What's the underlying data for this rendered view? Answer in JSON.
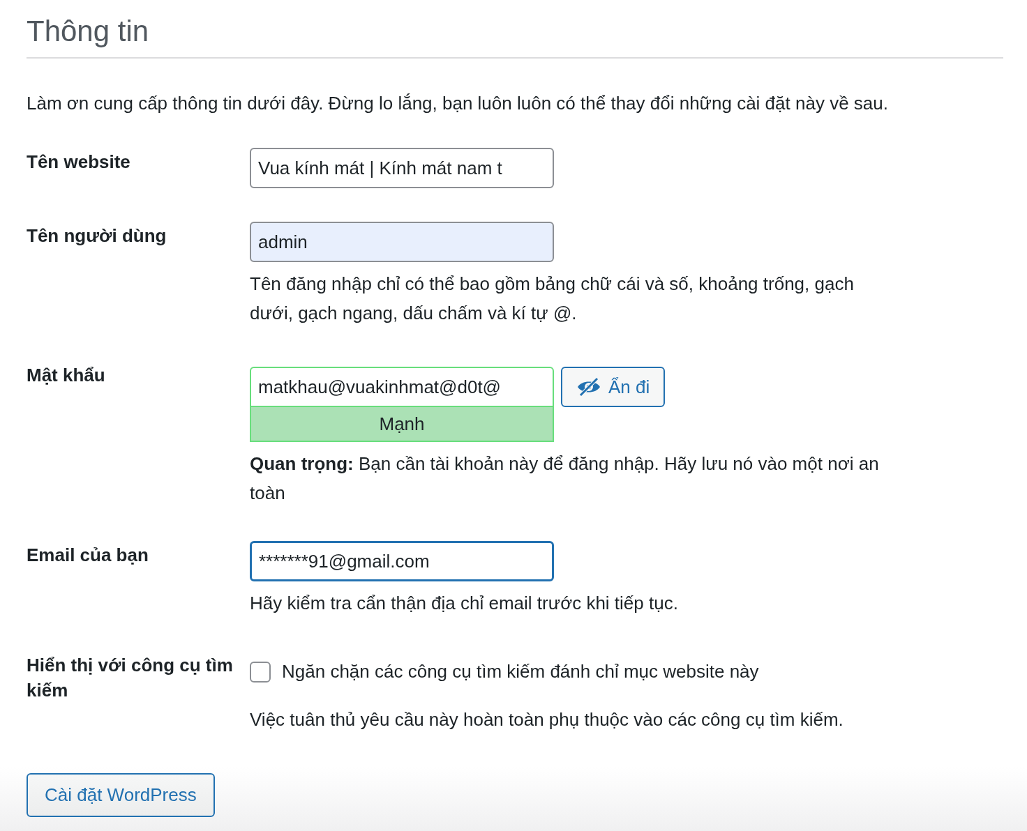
{
  "title": "Thông tin",
  "intro": "Làm ơn cung cấp thông tin dưới đây. Đừng lo lắng, bạn luôn luôn có thể thay đổi những cài đặt này về sau.",
  "fields": [
    {
      "kind": "text",
      "label": "Tên website",
      "value": "Vua kính mát | Kính mát nam t",
      "autofilled": false,
      "focused": false
    },
    {
      "kind": "text",
      "label": "Tên người dùng",
      "value": "admin",
      "autofilled": true,
      "focused": false,
      "help": "Tên đăng nhập chỉ có thể bao gồm bảng chữ cái và số, khoảng trống, gạch dưới, gạch ngang, dấu chấm và kí tự @."
    },
    {
      "kind": "password",
      "label": "Mật khẩu",
      "value": "matkhau@vuakinhmat@d0t@",
      "autofilled": false,
      "focused": false,
      "toggle": "Ẩn đi",
      "strength_meter": {
        "kind": "strong",
        "label": "Mạnh"
      },
      "help": "**Quan trọng:** Bạn cần tài khoản này để đăng nhập. Hãy lưu nó vào một nơi an toàn"
    },
    {
      "kind": "text",
      "label": "Email của bạn",
      "value": "*******91@gmail.com",
      "autofilled": false,
      "focused": true,
      "help": "Hãy kiểm tra cẩn thận địa chỉ email trước khi tiếp tục."
    },
    {
      "kind": "checkbox",
      "label": "Hiển thị với công cụ tìm kiếm",
      "checked": false,
      "option": "Ngăn chặn các công cụ tìm kiếm đánh chỉ mục website này",
      "help": "Việc tuân thủ yêu cầu này hoàn toàn phụ thuộc vào các công cụ tìm kiếm."
    }
  ],
  "submit": "Cài đặt WordPress"
}
